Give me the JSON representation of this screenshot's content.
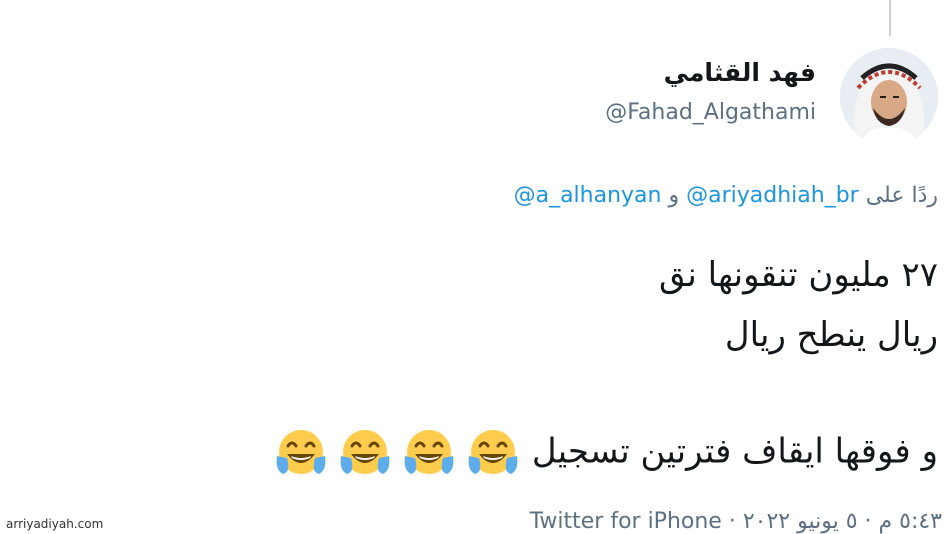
{
  "tweet": {
    "display_name": "فهد القثامي",
    "handle": "@Fahad_Algathami",
    "reply": {
      "prefix": "ردًا على",
      "mention1": "@ariyadhiah_br",
      "conjunction": "و",
      "mention2": "@a_alhanyan"
    },
    "lines": [
      "٢٧ مليون تنقونها نق",
      "ريال ينطح ريال",
      "و فوقها ايقاف فترتين تسجيل"
    ],
    "emoji_count": 4,
    "emoji_name": "face-with-tears-of-joy",
    "timestamp": "٥:٤٣ م · ٥ يونيو ٢٠٢٢",
    "source": "Twitter for iPhone"
  },
  "watermark": "arriyadiyah.com",
  "colors": {
    "text": "#14171a",
    "secondary": "#5b7083",
    "link": "#1b95e0",
    "emoji_face": "#ffcc4d"
  }
}
